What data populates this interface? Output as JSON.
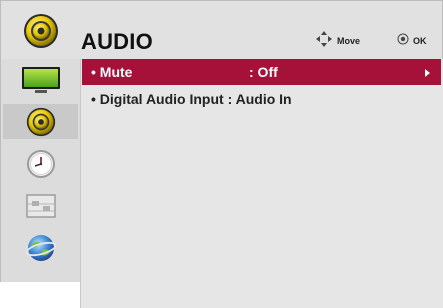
{
  "header": {
    "title": "AUDIO",
    "icon": "audio-speaker-icon",
    "hints": {
      "move_label": "Move",
      "move_icon": "four-way-arrows-icon",
      "ok_label": "OK",
      "ok_icon": "ok-button-icon"
    }
  },
  "sidebar": {
    "items": [
      {
        "name": "picture",
        "icon": "tv-screen-icon"
      },
      {
        "name": "audio",
        "icon": "audio-speaker-icon",
        "selected": true
      },
      {
        "name": "time",
        "icon": "clock-icon"
      },
      {
        "name": "option",
        "icon": "toolbox-icon"
      },
      {
        "name": "network",
        "icon": "globe-icon"
      }
    ]
  },
  "menu": {
    "rows": [
      {
        "label": "• Mute",
        "value": ": Off",
        "selected": true
      },
      {
        "label": "• Digital Audio Input : Audio In",
        "selected": false
      }
    ]
  },
  "colors": {
    "highlight": "#a6113a",
    "frame": "#e1e1e1",
    "speaker_yellow": "#e7c600"
  }
}
